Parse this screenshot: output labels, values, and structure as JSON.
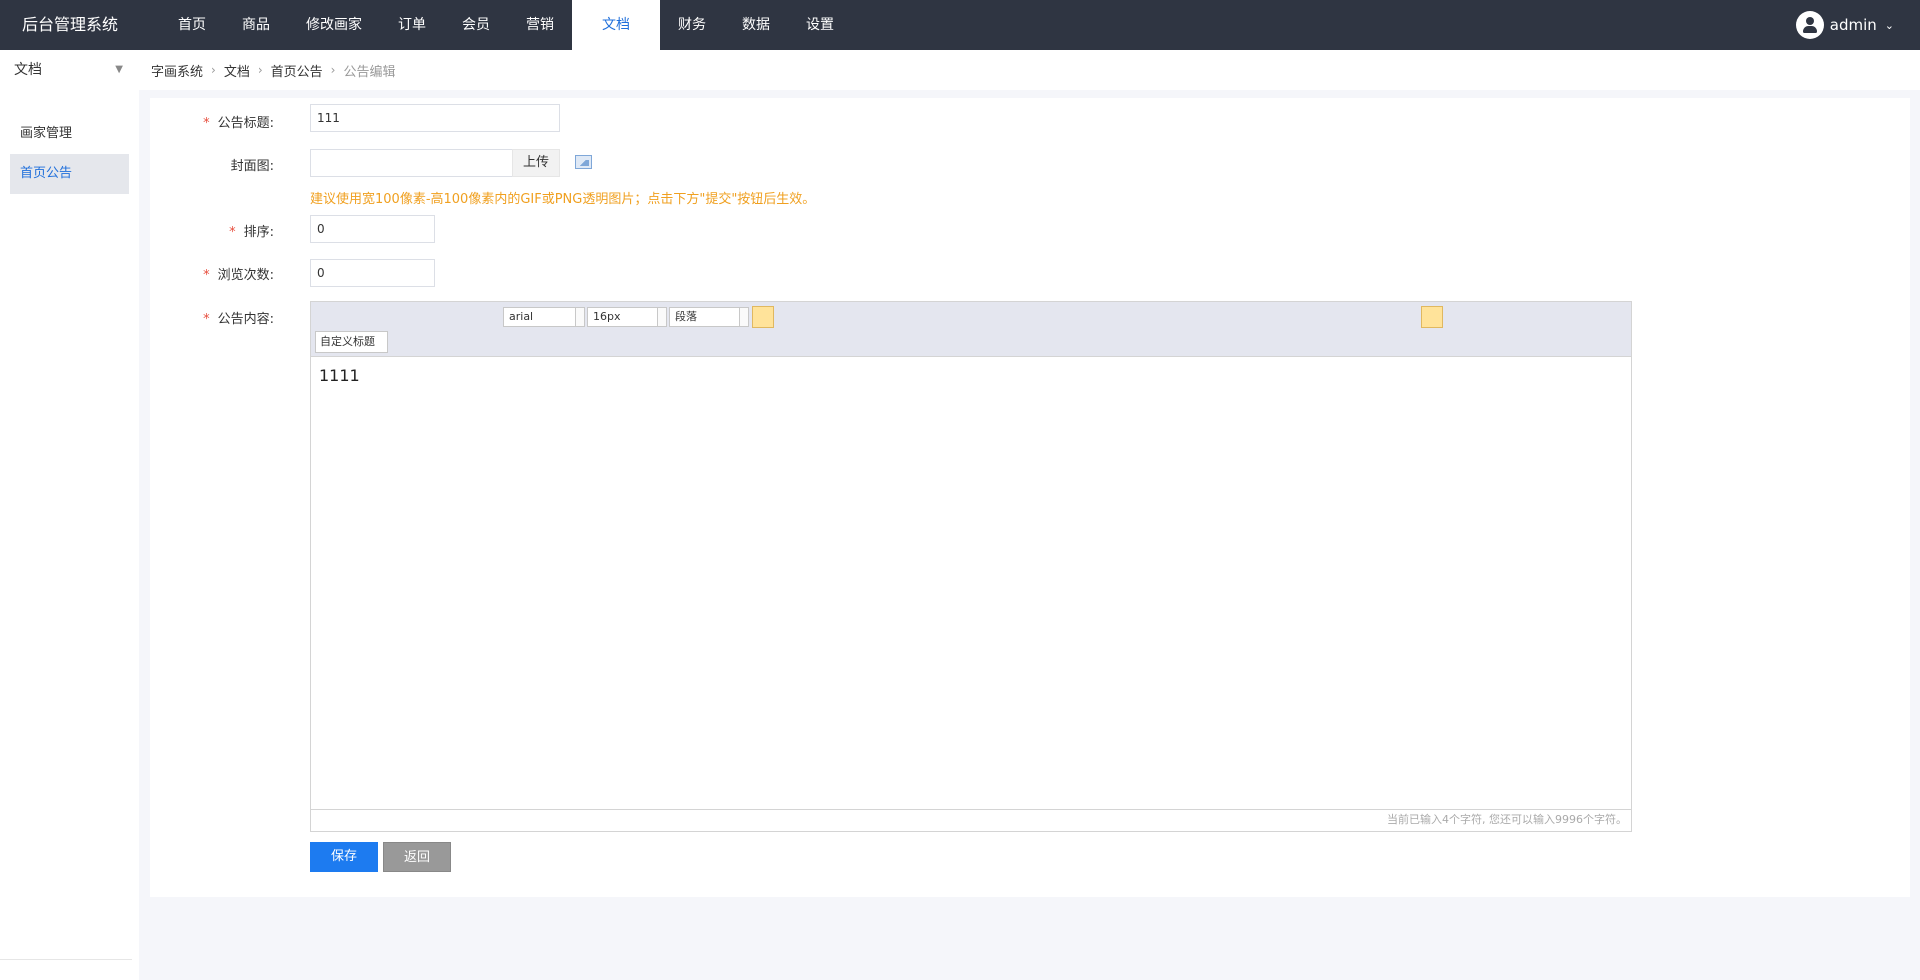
{
  "brand": "后台管理系统",
  "nav": [
    "首页",
    "商品",
    "修改画家",
    "订单",
    "会员",
    "营销",
    "文档",
    "财务",
    "数据",
    "设置"
  ],
  "nav_active_index": 6,
  "user": {
    "name": "admin",
    "icon": "user-icon"
  },
  "sidebar": {
    "select_value": "文档",
    "items": [
      {
        "label": "画家管理",
        "active": false
      },
      {
        "label": "首页公告",
        "active": true
      }
    ]
  },
  "breadcrumb": [
    "字画系统",
    "文档",
    "首页公告",
    "公告编辑"
  ],
  "form": {
    "title_label": "公告标题:",
    "title_value": "111",
    "cover_label": "封面图:",
    "cover_value": "",
    "upload_label": "上传",
    "hint": "建议使用宽100像素-高100像素内的GIF或PNG透明图片；点击下方\"提交\"按钮后生效。",
    "sort_label": "排序:",
    "sort_value": "0",
    "views_label": "浏览次数:",
    "views_value": "0",
    "content_label": "公告内容:"
  },
  "editor": {
    "font_family": "arial",
    "font_size": "16px",
    "paragraph": "段落",
    "custom_title": "自定义标题",
    "content": "1111",
    "counter": "当前已输入4个字符, 您还可以输入9996个字符。"
  },
  "buttons": {
    "save": "保存",
    "back": "返回"
  },
  "colors": {
    "topbar": "#2f3542",
    "accent": "#1d7bf0",
    "hint": "#f0a020",
    "required": "#e74c3c"
  }
}
